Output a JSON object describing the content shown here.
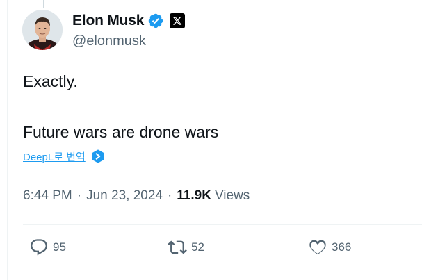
{
  "author": {
    "name": "Elon Musk",
    "handle": "@elonmusk",
    "verified": true,
    "affiliation_badge": "x-logo-icon"
  },
  "tweet": {
    "lines": [
      "Exactly.",
      "Future wars are drone wars"
    ]
  },
  "translate": {
    "label": "DeepL로 번역"
  },
  "meta": {
    "time": "6:44 PM",
    "separator1": "·",
    "date": "Jun 23, 2024",
    "separator2": "·",
    "views_count": "11.9K",
    "views_label": "Views"
  },
  "actions": {
    "replies": "95",
    "retweets": "52",
    "likes": "366"
  },
  "colors": {
    "verified_blue": "#1d9bf0",
    "secondary_text": "#536471",
    "primary_text": "#0f1419",
    "link_blue": "#1d9bf0"
  }
}
